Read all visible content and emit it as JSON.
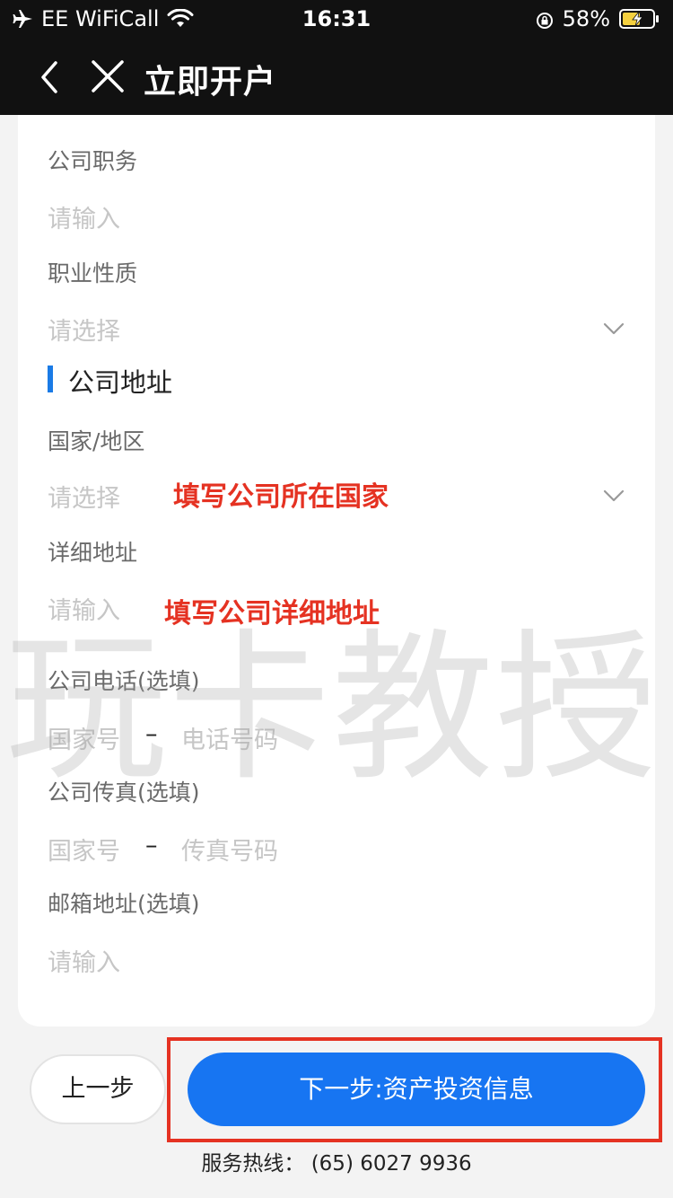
{
  "status_bar": {
    "carrier": "EE WiFiCall",
    "time": "16:31",
    "battery": "58%"
  },
  "nav": {
    "title": "立即开户"
  },
  "form": {
    "company_position": {
      "label": "公司职务",
      "placeholder": "请输入"
    },
    "occupation_type": {
      "label": "职业性质",
      "placeholder": "请选择"
    },
    "section_title": "公司地址",
    "country_region": {
      "label": "国家/地区",
      "placeholder": "请选择",
      "annotation": "填写公司所在国家"
    },
    "detail_address": {
      "label": "详细地址",
      "placeholder": "请输入",
      "annotation": "填写公司详细地址"
    },
    "company_phone": {
      "label": "公司电话(选填)",
      "country_placeholder": "国家号",
      "separator": "–",
      "number_placeholder": "电话号码"
    },
    "company_fax": {
      "label": "公司传真(选填)",
      "country_placeholder": "国家号",
      "separator": "–",
      "number_placeholder": "传真号码"
    },
    "email": {
      "label": "邮箱地址(选填)",
      "placeholder": "请输入"
    }
  },
  "watermark": "玩卡教授",
  "buttons": {
    "prev": "上一步",
    "next": "下一步:资产投资信息"
  },
  "hotline": "服务热线： (65) 6027 9936",
  "colors": {
    "header_bg": "#111111",
    "accent": "#1775f2",
    "annotation": "#e53222",
    "placeholder": "#c6c6c6"
  }
}
